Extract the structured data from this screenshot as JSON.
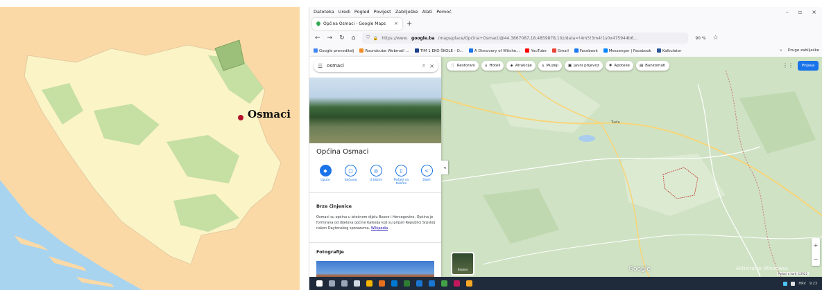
{
  "left_map": {
    "label": "Osmaci",
    "colors": {
      "background": "#fbd9a7",
      "sea": "#a8d4ef",
      "country_light": "#fbf4c7",
      "country_green": "#c6dfa3",
      "highlight_region": "#9cc07a",
      "marker": "#b3122b"
    }
  },
  "browser": {
    "menu": [
      "Datoteka",
      "Uredi",
      "Pogled",
      "Povijest",
      "Zabilješke",
      "Alati",
      "Pomoć"
    ],
    "window_controls": [
      "–",
      "▫",
      "×"
    ],
    "tab_title": "Općina Osmaci - Google Maps",
    "tab_close": "×",
    "new_tab": "+",
    "nav_icons": [
      "←",
      "→",
      "↻",
      "⌂"
    ],
    "url_prefix": "https://www.",
    "url_domain": "google.ba",
    "url_rest": "/maps/place/Općina+Osmaci/@44.3867087,18.4859878,10z/data=!4m5!3m4!1s0x475944b6...",
    "zoom_level": "90 %",
    "bookmarks": [
      {
        "label": "Google prevoditelj",
        "color": "#4285f4"
      },
      {
        "label": "Roundcube Webmail ...",
        "color": "#f28c28"
      },
      {
        "label": "TIM 1 EKO ŠKOLE - O...",
        "color": "#1b3f8b"
      },
      {
        "label": "A Discovery of Witche...",
        "color": "#1a73e8"
      },
      {
        "label": "YouTube",
        "color": "#ff0000"
      },
      {
        "label": "Gmail",
        "color": "#ea4335"
      },
      {
        "label": "Facebook",
        "color": "#1877f2"
      },
      {
        "label": "Messenger | Facebook",
        "color": "#0084ff"
      },
      {
        "label": "Kalkulator",
        "color": "#2b579a"
      }
    ],
    "bookmarks_more": "»",
    "other_bookmarks": "Druge zabilješke"
  },
  "maps": {
    "search_value": "osmaci",
    "search_icon": "⌕",
    "close_icon": "×",
    "menu_icon": "☰",
    "place_title": "Općina Osmaci",
    "actions": [
      {
        "label": "Upute",
        "glyph": "◆",
        "primary": true
      },
      {
        "label": "Sačuvaj",
        "glyph": "▢",
        "primary": false
      },
      {
        "label": "U blizini",
        "glyph": "◎",
        "primary": false
      },
      {
        "label": "Pošalji na telefon",
        "glyph": "▯",
        "primary": false
      },
      {
        "label": "Dijeli",
        "glyph": "<",
        "primary": false
      }
    ],
    "quick_facts_title": "Brze činjenice",
    "description": "Osmaci su općina u istočnom dijelu Bosne i Hercegovine. Općina je formirana od dijelova općine Kalesija koji su pripali Republici Srpskoj nakon Daytonskog sporazuma.",
    "description_link": "Wikipedia",
    "photos_title": "Fotografije",
    "chips": [
      {
        "label": "Restorani",
        "glyph": "🍴"
      },
      {
        "label": "Hoteli",
        "glyph": "⌂"
      },
      {
        "label": "Atrakcije",
        "glyph": "◈"
      },
      {
        "label": "Muzeji",
        "glyph": "⌂"
      },
      {
        "label": "Javni prijevoz",
        "glyph": "▣"
      },
      {
        "label": "Apoteke",
        "glyph": "✚"
      },
      {
        "label": "Bankomati",
        "glyph": "▤"
      }
    ],
    "sign_in": "Prijava",
    "layers_label": "Slojevi",
    "town_label": "Tuzla",
    "collapse": "◂",
    "zoom_in": "+",
    "zoom_out": "−",
    "google_mark": "Google",
    "attribution": "Podaci o karti ©2022",
    "watermark": "Aktiviranje Windowsa"
  },
  "taskbar": {
    "icons": [
      "#ffffff",
      "#9aa7b8",
      "#9aa7b8",
      "#cfd8e3",
      "#f4b400",
      "#e76f1e",
      "#0078d4",
      "#2e7d32",
      "#1976d2",
      "#1976d2",
      "#43a047",
      "#c2185b",
      "#f9a825"
    ],
    "tray_text": "HRV",
    "time": "9:23"
  }
}
